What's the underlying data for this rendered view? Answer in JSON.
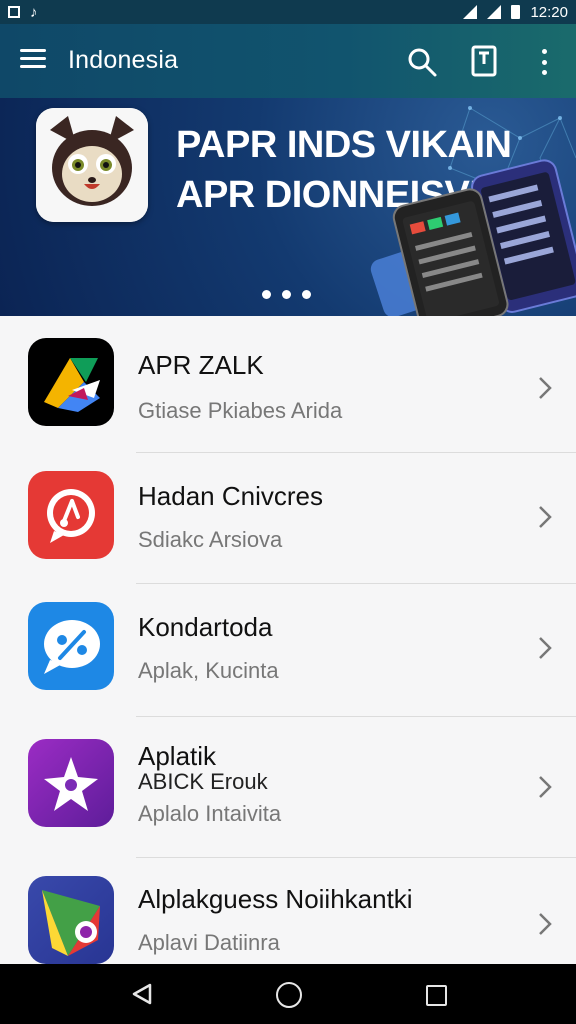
{
  "status_bar": {
    "time": "12:20"
  },
  "app_bar": {
    "title": "Indonesia"
  },
  "banner": {
    "line1": "PAPR INDS VIKAIN",
    "line2": "APR DIONNEISVIA",
    "page_count": 3
  },
  "apps": [
    {
      "title": "APR ZALK",
      "subtitle": "Gtiase Pkiabes Arida"
    },
    {
      "title": "Hadan Cnivcres",
      "subtitle": "Sdiakc Arsiova"
    },
    {
      "title": "Kondartoda",
      "subtitle": "Aplak, Kucinta"
    },
    {
      "title": "Aplatik",
      "title2": "ABICK Erouk",
      "subtitle": "Aplalo Intaivita"
    },
    {
      "title": "Alplakguess Noiihkantki",
      "subtitle": "Aplavi Datiinra"
    }
  ],
  "colors": {
    "app_bar": "#11546e",
    "banner": "#133a70",
    "icon_red": "#e53935",
    "icon_blue": "#1e88e5",
    "icon_purple": "#7b2bb5"
  },
  "icons": {
    "menu": "hamburger-icon",
    "search": "search-icon",
    "document": "document-icon",
    "more": "more-vert-icon",
    "back": "back-triangle-icon",
    "home": "home-circle-icon",
    "recents": "recents-square-icon"
  }
}
